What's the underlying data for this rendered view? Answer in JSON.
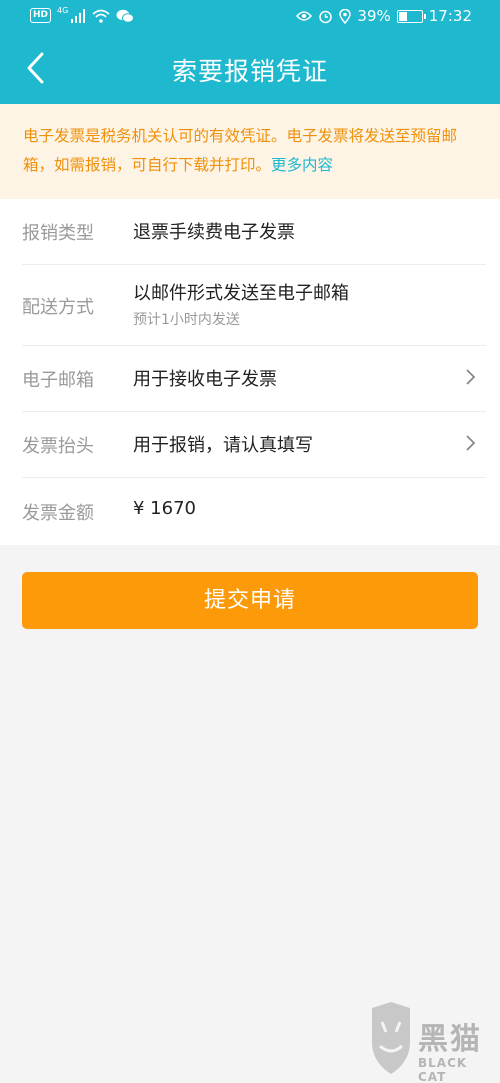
{
  "status_bar": {
    "hd": "HD",
    "network": "4G",
    "battery": "39%",
    "battery_level": 0.39,
    "time": "17:32"
  },
  "header": {
    "title": "索要报销凭证",
    "back_icon": "chevron-left-icon"
  },
  "notice": {
    "text": "电子发票是税务机关认可的有效凭证。电子发票将发送至预留邮箱，如需报销，可自行下载并打印。",
    "link": "更多内容"
  },
  "form": {
    "rows": [
      {
        "label": "报销类型",
        "value": "退票手续费电子发票"
      },
      {
        "label": "配送方式",
        "value": "以邮件形式发送至电子邮箱",
        "sub": "预计1小时内发送"
      },
      {
        "label": "电子邮箱",
        "value": "用于接收电子发票"
      },
      {
        "label": "发票抬头",
        "value": "用于报销，请认真填写"
      },
      {
        "label": "发票金额",
        "value": "¥ 1670"
      }
    ]
  },
  "submit_label": "提交申请",
  "watermark": {
    "cn": "黑猫",
    "en": "BLACK CAT"
  },
  "colors": {
    "header": "#1eb8cf",
    "notice_bg": "#fdf4e6",
    "notice_text": "#f0900a",
    "button": "#fc9a0a"
  }
}
